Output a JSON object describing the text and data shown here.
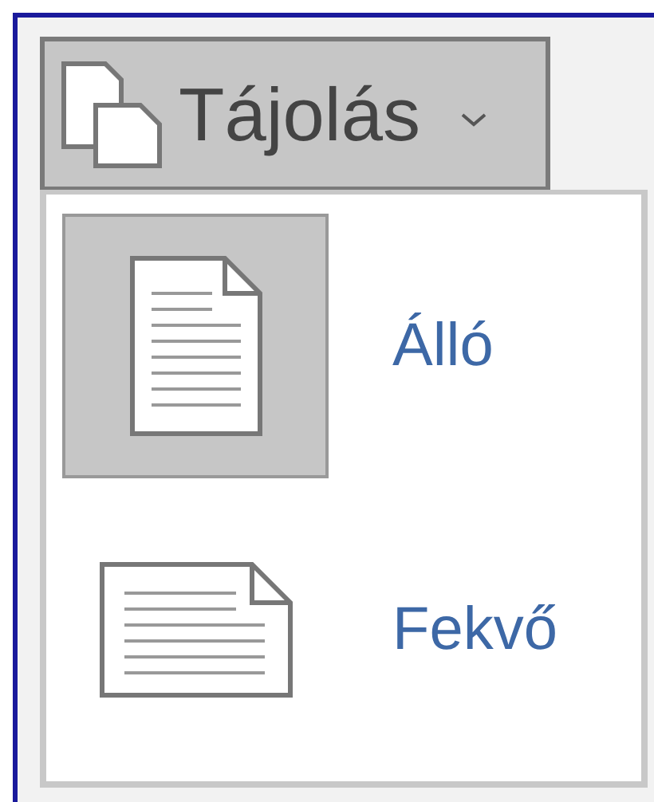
{
  "button": {
    "label": "Tájolás",
    "expanded": true
  },
  "menu": {
    "items": [
      {
        "label": "Álló",
        "kind": "portrait",
        "selected": true
      },
      {
        "label": "Fekvő",
        "kind": "landscape",
        "selected": false
      }
    ]
  }
}
